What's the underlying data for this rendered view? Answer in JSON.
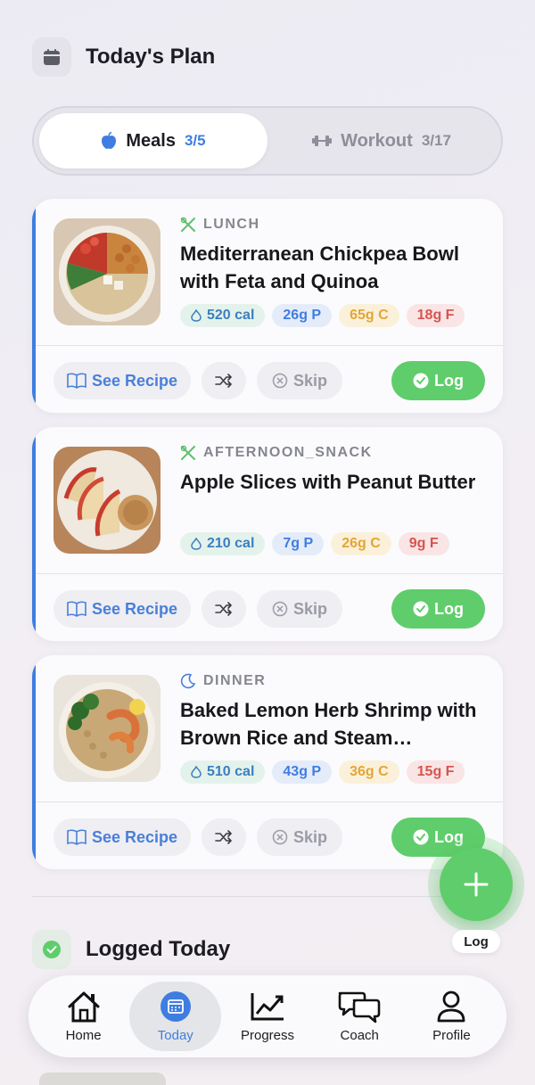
{
  "header": {
    "title": "Today's Plan",
    "icon": "calendar-icon"
  },
  "tabs": [
    {
      "label": "Meals",
      "count": "3/5",
      "icon": "apple-icon",
      "active": true
    },
    {
      "label": "Workout",
      "count": "3/17",
      "icon": "dumbbell-icon",
      "active": false
    }
  ],
  "meals": [
    {
      "type": "LUNCH",
      "type_icon": "utensils-icon",
      "name": "Mediterranean Chickpea Bowl with Feta and Quinoa",
      "calories": "520 cal",
      "protein": "26g P",
      "carbs": "65g C",
      "fat": "18g F"
    },
    {
      "type": "AFTERNOON_SNACK",
      "type_icon": "utensils-icon",
      "name": "Apple Slices with Peanut Butter",
      "calories": "210 cal",
      "protein": "7g P",
      "carbs": "26g C",
      "fat": "9g F"
    },
    {
      "type": "DINNER",
      "type_icon": "moon-icon",
      "name": "Baked Lemon Herb Shrimp with Brown Rice and Steam…",
      "calories": "510 cal",
      "protein": "43g P",
      "carbs": "36g C",
      "fat": "15g F"
    }
  ],
  "actions": {
    "recipe": "See Recipe",
    "skip": "Skip",
    "log": "Log"
  },
  "fab": {
    "label": "Log"
  },
  "logged": {
    "title": "Logged Today"
  },
  "nav": [
    {
      "label": "Home",
      "icon": "home-icon"
    },
    {
      "label": "Today",
      "icon": "calendar-icon",
      "active": true
    },
    {
      "label": "Progress",
      "icon": "chart-icon"
    },
    {
      "label": "Coach",
      "icon": "chat-icon"
    },
    {
      "label": "Profile",
      "icon": "user-icon"
    }
  ],
  "colors": {
    "accent": "#3f7de0",
    "success": "#5fcd6b"
  }
}
